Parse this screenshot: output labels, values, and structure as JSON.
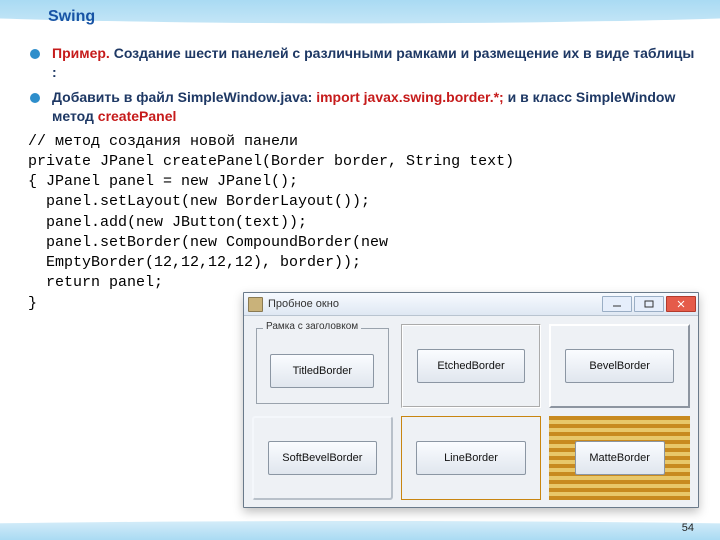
{
  "heading": "Swing",
  "bullets": [
    {
      "prefix": " ",
      "red1": "Пример.",
      "rest": " Создание шести панелей с различными рамками и размещение их в виде таблицы :"
    },
    {
      "text1": "Добавить  в файл SimpleWindow.java:  ",
      "red": "import javax.swing.border.*;",
      "text2": " и в класс SimpleWindow  метод  ",
      "red2": "createPanel"
    }
  ],
  "code": "// метод создания новой панели\nprivate JPanel createPanel(Border border, String text)\n{ JPanel panel = new JPanel();\n  panel.setLayout(new BorderLayout());\n  panel.add(new JButton(text));\n  panel.setBorder(new CompoundBorder(new\n  EmptyBorder(12,12,12,12), border));\n  return panel;\n}",
  "window": {
    "title": "Пробное окно",
    "titled_label": "Рамка с заголовком",
    "panels": [
      "TitledBorder",
      "EtchedBorder",
      "BevelBorder",
      "SoftBevelBorder",
      "LineBorder",
      "MatteBorder"
    ]
  },
  "pagenum": "54"
}
